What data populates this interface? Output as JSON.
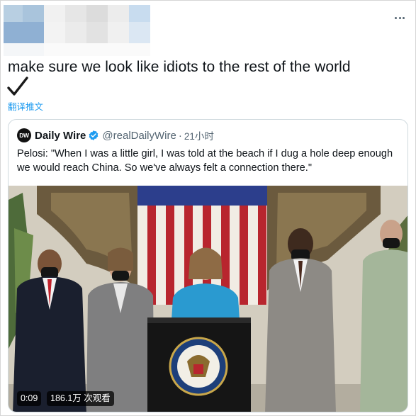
{
  "tweet": {
    "text": "make sure we look like idiots to the rest of the world",
    "translate_label": "翻译推文"
  },
  "quoted_tweet": {
    "author_name": "Daily Wire",
    "author_logo_text": "DW",
    "handle": "@realDailyWire",
    "separator": "·",
    "time_ago": "21小时",
    "text": "Pelosi: \"When I was a little girl, I was told at the beach if I dug a hole deep enough we would reach China. So we've always felt a connection there.\""
  },
  "video": {
    "duration": "0:09",
    "views": "186.1万 次观看"
  },
  "icons": {
    "more": "more-horizontal-icon",
    "check": "checkmark-icon",
    "verified": "verified-badge-icon"
  },
  "colors": {
    "link": "#1d9bf0",
    "verified": "#1d9bf0",
    "secondary_text": "#536471"
  }
}
